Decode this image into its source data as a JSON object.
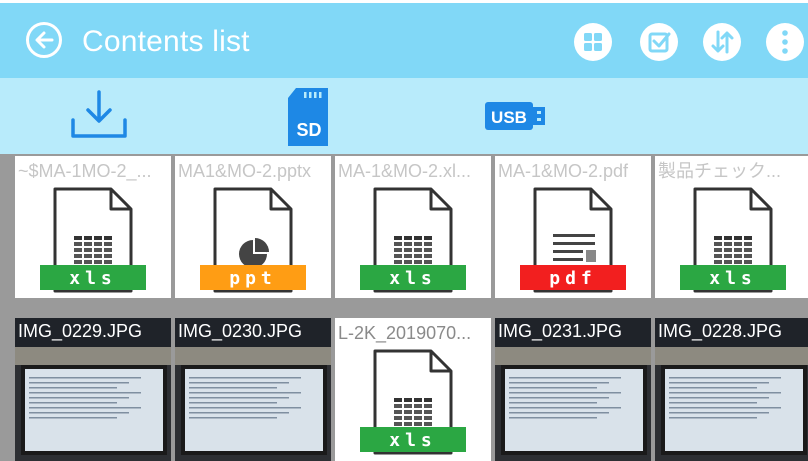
{
  "appbar": {
    "title": "Contents list",
    "back_icon": "back-arrow-circle-icon",
    "actions": [
      "grid-view-icon",
      "select-check-icon",
      "sort-icon",
      "more-vert-icon"
    ],
    "bg": "#81d8f7"
  },
  "sources": {
    "download_icon": "download-icon",
    "sd_label": "SD",
    "usb_label": "USB",
    "bg": "#b8ebfb",
    "accent": "#1e88e5"
  },
  "files": [
    {
      "name": "~$MA-1MO-2_...",
      "kind": "doc",
      "badge": "xls",
      "badge_color": "#2ba743",
      "icon": "spreadsheet-file-icon"
    },
    {
      "name": "MA1&MO-2.pptx",
      "kind": "doc",
      "badge": "ppt",
      "badge_color": "#ff9d14",
      "icon": "presentation-file-icon"
    },
    {
      "name": "MA-1&MO-2.xl...",
      "kind": "doc",
      "badge": "xls",
      "badge_color": "#2ba743",
      "icon": "spreadsheet-file-icon"
    },
    {
      "name": "MA-1&MO-2.pdf",
      "kind": "doc",
      "badge": "pdf",
      "badge_color": "#f21f1f",
      "icon": "pdf-file-icon"
    },
    {
      "name": "製品チェック...",
      "kind": "doc",
      "badge": "xls",
      "badge_color": "#2ba743",
      "icon": "spreadsheet-file-icon"
    },
    {
      "name": "IMG_0229.JPG",
      "kind": "img",
      "icon": "photo-thumbnail"
    },
    {
      "name": "IMG_0230.JPG",
      "kind": "img",
      "icon": "photo-thumbnail"
    },
    {
      "name": "L-2K_2019070...",
      "kind": "doc",
      "badge": "xls",
      "badge_color": "#2ba743",
      "icon": "spreadsheet-file-icon"
    },
    {
      "name": "IMG_0231.JPG",
      "kind": "img",
      "icon": "photo-thumbnail"
    },
    {
      "name": "IMG_0228.JPG",
      "kind": "img",
      "icon": "photo-thumbnail"
    }
  ]
}
